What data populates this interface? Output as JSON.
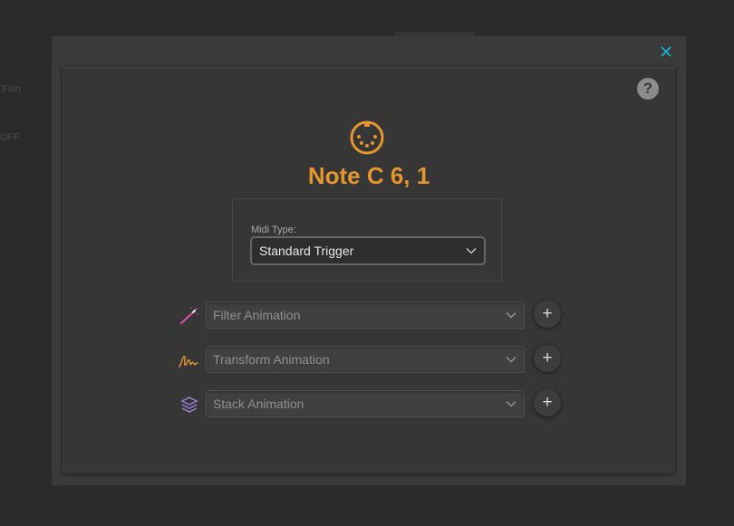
{
  "background": {
    "label_1": "Filth",
    "label_2": "OFF"
  },
  "modal": {
    "close_icon": "close-icon",
    "help_label": "?",
    "icon_name": "midi-icon",
    "title": "Note C 6, 1",
    "midi_type": {
      "label": "Midi Type:",
      "value": "Standard Trigger"
    },
    "animations": [
      {
        "icon": "magic-wand-icon",
        "placeholder": "Filter Animation",
        "add_label": "+"
      },
      {
        "icon": "signature-icon",
        "placeholder": "Transform Animation",
        "add_label": "+"
      },
      {
        "icon": "layers-icon",
        "placeholder": "Stack Animation",
        "add_label": "+"
      }
    ]
  },
  "colors": {
    "accent": "#e5962f",
    "close": "#14b3c7"
  }
}
